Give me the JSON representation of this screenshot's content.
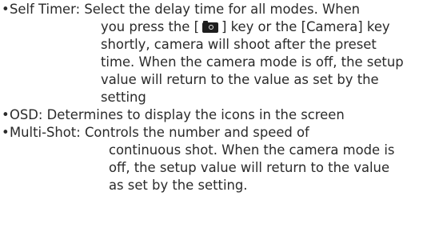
{
  "bullet": "•",
  "items": [
    {
      "lines": [
        "Self Timer: Select the delay time for all modes. When",
        "you press the [",
        "] key or the [Camera] key",
        "shortly, camera will shoot after the preset",
        "time. When the camera mode is off, the setup",
        "value will return to the value as set by the",
        "setting"
      ]
    },
    {
      "lines": [
        "OSD: Determines to display the icons in the screen"
      ]
    },
    {
      "lines": [
        "Multi-Shot: Controls the number and speed of",
        "continuous shot. When the camera mode is",
        "off, the setup value will return to the value",
        "as set by the setting."
      ]
    }
  ],
  "icons": {
    "camera_key": "camera-icon"
  }
}
